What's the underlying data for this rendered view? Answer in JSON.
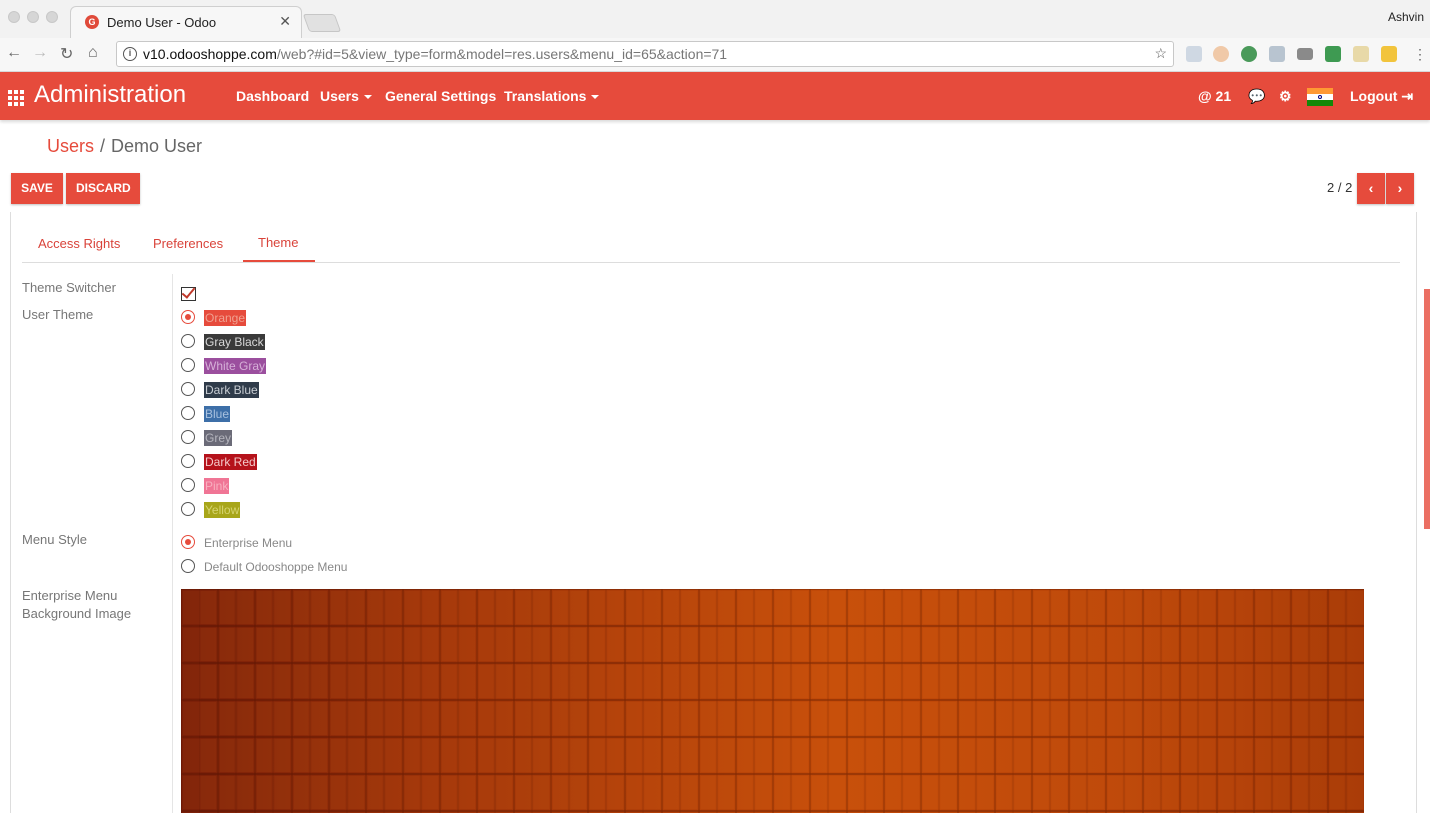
{
  "browser": {
    "tab_title": "Demo User - Odoo",
    "tab_close": "✕",
    "profile_name": "Ashvin",
    "url_host": "v10.odooshoppe.com",
    "url_path": "/web?#id=5&view_type=form&model=res.users&menu_id=65&action=71"
  },
  "navbar": {
    "app_title": "Administration",
    "menu": [
      "Dashboard",
      "Users",
      "General Settings",
      "Translations"
    ],
    "mentions": "@ 21",
    "logout_label": "Logout"
  },
  "breadcrumb": {
    "parent": "Users",
    "separator": "/",
    "current": "Demo User"
  },
  "actions": {
    "save_label": "SAVE",
    "discard_label": "DISCARD"
  },
  "pager": {
    "value": "2 / 2",
    "prev": "‹",
    "next": "›"
  },
  "form_tabs": [
    "Access Rights",
    "Preferences",
    "Theme"
  ],
  "active_tab": "Theme",
  "fields": {
    "theme_switcher_label": "Theme Switcher",
    "theme_switcher_checked": true,
    "user_theme_label": "User Theme",
    "themes": [
      {
        "name": "Orange",
        "bg": "#e64b3c",
        "fg": "#f0a090",
        "selected": true
      },
      {
        "name": "Gray Black",
        "bg": "#3a3a3a",
        "fg": "#d8d8d8",
        "selected": false
      },
      {
        "name": "White Gray",
        "bg": "#9b4f9e",
        "fg": "#d6b0d8",
        "selected": false
      },
      {
        "name": "Dark Blue",
        "bg": "#2f3b4a",
        "fg": "#c8cdd3",
        "selected": false
      },
      {
        "name": "Blue",
        "bg": "#3d6fa8",
        "fg": "#a7c0de",
        "selected": false
      },
      {
        "name": "Grey",
        "bg": "#6b6b78",
        "fg": "#b5b5bd",
        "selected": false
      },
      {
        "name": "Dark Red",
        "bg": "#b5121b",
        "fg": "#f4c8c8",
        "selected": false
      },
      {
        "name": "Pink",
        "bg": "#f07595",
        "fg": "#f8b0c0",
        "selected": false
      },
      {
        "name": "Yellow",
        "bg": "#a8a61a",
        "fg": "#d6d470",
        "selected": false
      }
    ],
    "menu_style_label": "Menu Style",
    "menu_styles": [
      {
        "name": "Enterprise Menu",
        "selected": true
      },
      {
        "name": "Default Odooshoppe Menu",
        "selected": false
      }
    ],
    "bg_image_label_line1": "Enterprise Menu",
    "bg_image_label_line2": "Background Image"
  },
  "colors": {
    "accent": "#e64b3c"
  }
}
